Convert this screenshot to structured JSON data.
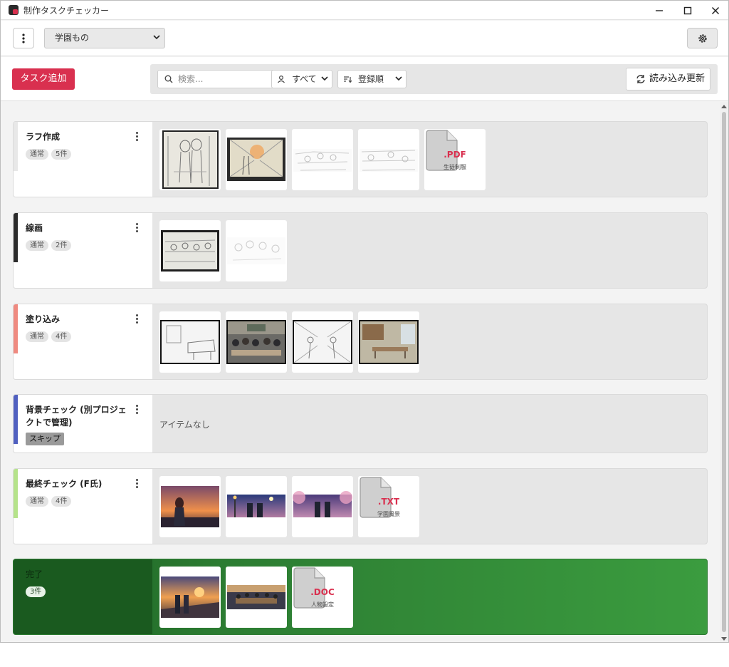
{
  "window": {
    "title": "制作タスクチェッカー"
  },
  "toolbar": {
    "project": "学園もの"
  },
  "actions": {
    "add_task": "タスク追加",
    "search_placeholder": "検索...",
    "filter": "すべて",
    "sort": "登録順",
    "reload": "読み込み更新"
  },
  "colors": {
    "accent": "#d9304f",
    "done_green": "#2c7c32"
  },
  "rows": [
    {
      "name": "ラフ作成",
      "status": "通常",
      "count": "5件",
      "bar_color": "#e8e8e8",
      "items": [
        {
          "kind": "image",
          "icon": "rough-sketch-corridor"
        },
        {
          "kind": "image",
          "icon": "rough-sketch-sunset-hallway"
        },
        {
          "kind": "image",
          "icon": "lineart-classroom-sketch"
        },
        {
          "kind": "image",
          "icon": "lineart-classroom-sketch"
        },
        {
          "kind": "file",
          "ext": ".PDF",
          "file_label": "生徒制服"
        }
      ]
    },
    {
      "name": "線画",
      "status": "通常",
      "count": "2件",
      "bar_color": "#2b2b2b",
      "items": [
        {
          "kind": "image",
          "icon": "lineart-classroom"
        },
        {
          "kind": "image",
          "icon": "lineart-group"
        }
      ]
    },
    {
      "name": "塗り込み",
      "status": "通常",
      "count": "4件",
      "bar_color": "#ef8a80",
      "items": [
        {
          "kind": "image",
          "icon": "lineart-piano-room"
        },
        {
          "kind": "image",
          "icon": "colored-cafeteria"
        },
        {
          "kind": "image",
          "icon": "lineart-hallway-students"
        },
        {
          "kind": "image",
          "icon": "colored-library"
        }
      ]
    },
    {
      "name": "背景チェック (別プロジェクトで管理)",
      "status": "スキップ",
      "bar_color": "#5060c0",
      "empty": "アイテムなし"
    },
    {
      "name": "最終チェック (F氏)",
      "status": "通常",
      "count": "4件",
      "bar_color": "#b5e38a",
      "items": [
        {
          "kind": "image",
          "icon": "sunset-city-girl"
        },
        {
          "kind": "image",
          "icon": "night-couple"
        },
        {
          "kind": "image",
          "icon": "sakura-couple"
        },
        {
          "kind": "file",
          "ext": ".TXT",
          "file_label": "学園風景"
        }
      ]
    },
    {
      "name": "完了",
      "count": "3件",
      "items": [
        {
          "kind": "image",
          "icon": "sunset-couple-road"
        },
        {
          "kind": "image",
          "icon": "meeting-room"
        },
        {
          "kind": "file",
          "ext": ".DOC",
          "file_label": "人物設定"
        }
      ]
    }
  ]
}
